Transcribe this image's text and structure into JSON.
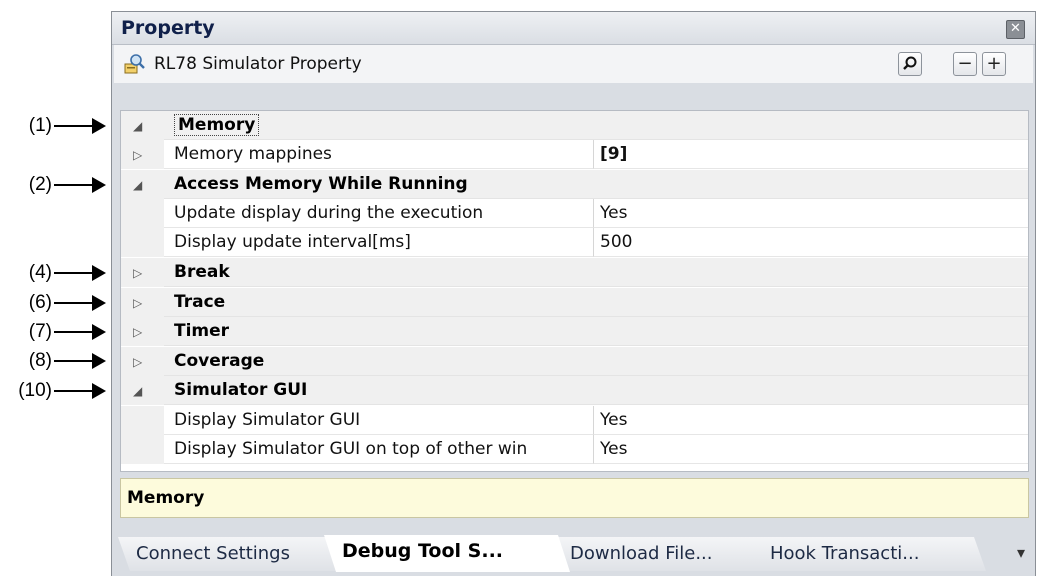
{
  "callouts": [
    "(1)",
    "(2)",
    "(4)",
    "(6)",
    "(7)",
    "(8)",
    "(10)"
  ],
  "panel": {
    "title": "Property",
    "close_glyph": "✕"
  },
  "toolbar": {
    "title": "RL78 Simulator Property",
    "icons": [
      "property-icon",
      "search-icon",
      "collapse-icon",
      "expand-icon"
    ],
    "search_glyph": "⚲",
    "collapse_glyph": "−",
    "expand_glyph": "+"
  },
  "grid": {
    "rows": [
      {
        "type": "category",
        "expanded": true,
        "label": "Memory"
      },
      {
        "type": "property",
        "expandable": true,
        "name": "Memory mappines",
        "value": "[9]"
      },
      {
        "type": "category",
        "expanded": true,
        "label": "Access Memory While Running"
      },
      {
        "type": "property",
        "name": "Update display during the execution",
        "value": "Yes"
      },
      {
        "type": "property",
        "name": "Display update interval[ms]",
        "value": "500"
      },
      {
        "type": "category",
        "expanded": false,
        "label": "Break"
      },
      {
        "type": "category",
        "expanded": false,
        "label": "Trace"
      },
      {
        "type": "category",
        "expanded": false,
        "label": "Timer"
      },
      {
        "type": "category",
        "expanded": false,
        "label": "Coverage"
      },
      {
        "type": "category",
        "expanded": true,
        "label": "Simulator GUI"
      },
      {
        "type": "property",
        "name": "Display Simulator GUI",
        "value": "Yes"
      },
      {
        "type": "property",
        "name": "Display Simulator GUI on top of other win",
        "value": "Yes"
      }
    ]
  },
  "description": "Memory",
  "tabs": [
    "Connect Settings",
    "Debug Tool S...",
    "Download File...",
    "Hook Transacti..."
  ],
  "active_tab": "Debug Tool S...",
  "tab_overflow_glyph": "▾",
  "colors": {
    "category_bg": "#f0f0f0",
    "description_bg": "#fdfbdc",
    "panel_bg": "#d9dde3"
  }
}
